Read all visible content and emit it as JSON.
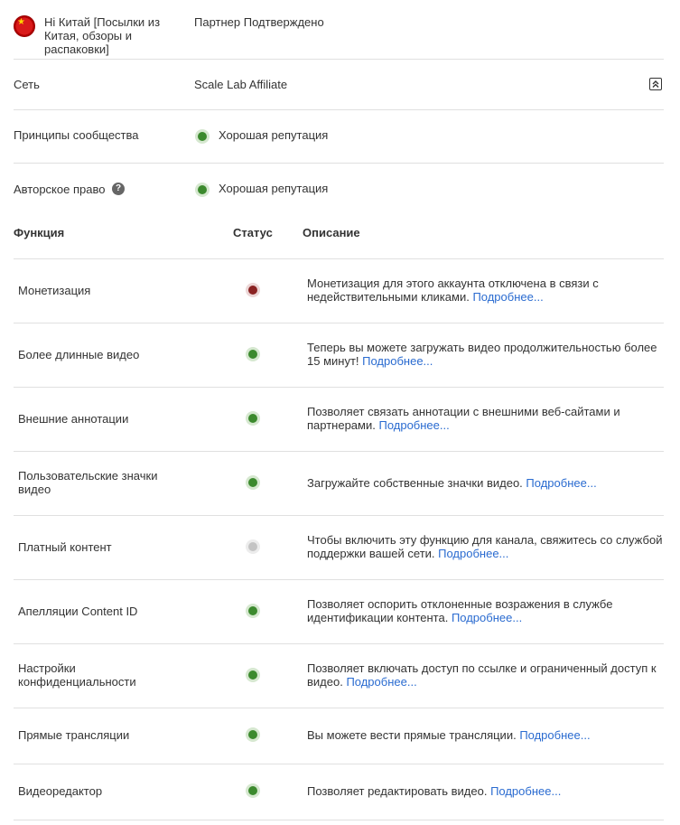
{
  "channel": {
    "name": "Hi Китай [Посылки из Китая, обзоры и распаковки]",
    "partner_status": "Партнер Подтверждено"
  },
  "network": {
    "label": "Сеть",
    "value": "Scale Lab Affiliate"
  },
  "community": {
    "label": "Принципы сообщества",
    "status": "Хорошая репутация",
    "status_color": "#3c8a2e"
  },
  "copyright": {
    "label": "Авторское право",
    "status": "Хорошая репутация",
    "status_color": "#3c8a2e"
  },
  "table": {
    "headers": {
      "feature": "Функция",
      "status": "Статус",
      "description": "Описание"
    },
    "more_label": "Подробнее...",
    "rows": [
      {
        "name": "Монетизация",
        "status": "red",
        "description": "Монетизация для этого аккаунта отключена в связи с недействительными кликами."
      },
      {
        "name": "Более длинные видео",
        "status": "green",
        "description": "Теперь вы можете загружать видео продолжительностью более 15 минут!"
      },
      {
        "name": "Внешние аннотации",
        "status": "green",
        "description": "Позволяет связать аннотации с внешними веб-сайтами и партнерами."
      },
      {
        "name": "Пользовательские значки видео",
        "status": "green",
        "description": "Загружайте собственные значки видео."
      },
      {
        "name": "Платный контент",
        "status": "gray",
        "description": "Чтобы включить эту функцию для канала, свяжитесь со службой поддержки вашей сети."
      },
      {
        "name": "Апелляции Content ID",
        "status": "green",
        "description": "Позволяет оспорить отклоненные возражения в службе идентификации контента."
      },
      {
        "name": "Настройки конфиденциальности",
        "status": "green",
        "description": "Позволяет включать доступ по ссылке и ограниченный доступ к видео."
      },
      {
        "name": "Прямые трансляции",
        "status": "green",
        "description": "Вы можете вести прямые трансляции."
      },
      {
        "name": "Видеоредактор",
        "status": "green",
        "description": "Позволяет редактировать видео."
      }
    ]
  },
  "colors": {
    "green": "#3c8a2e",
    "red": "#8b2323",
    "gray": "#c4c4c4",
    "link": "#2a6bd0"
  }
}
